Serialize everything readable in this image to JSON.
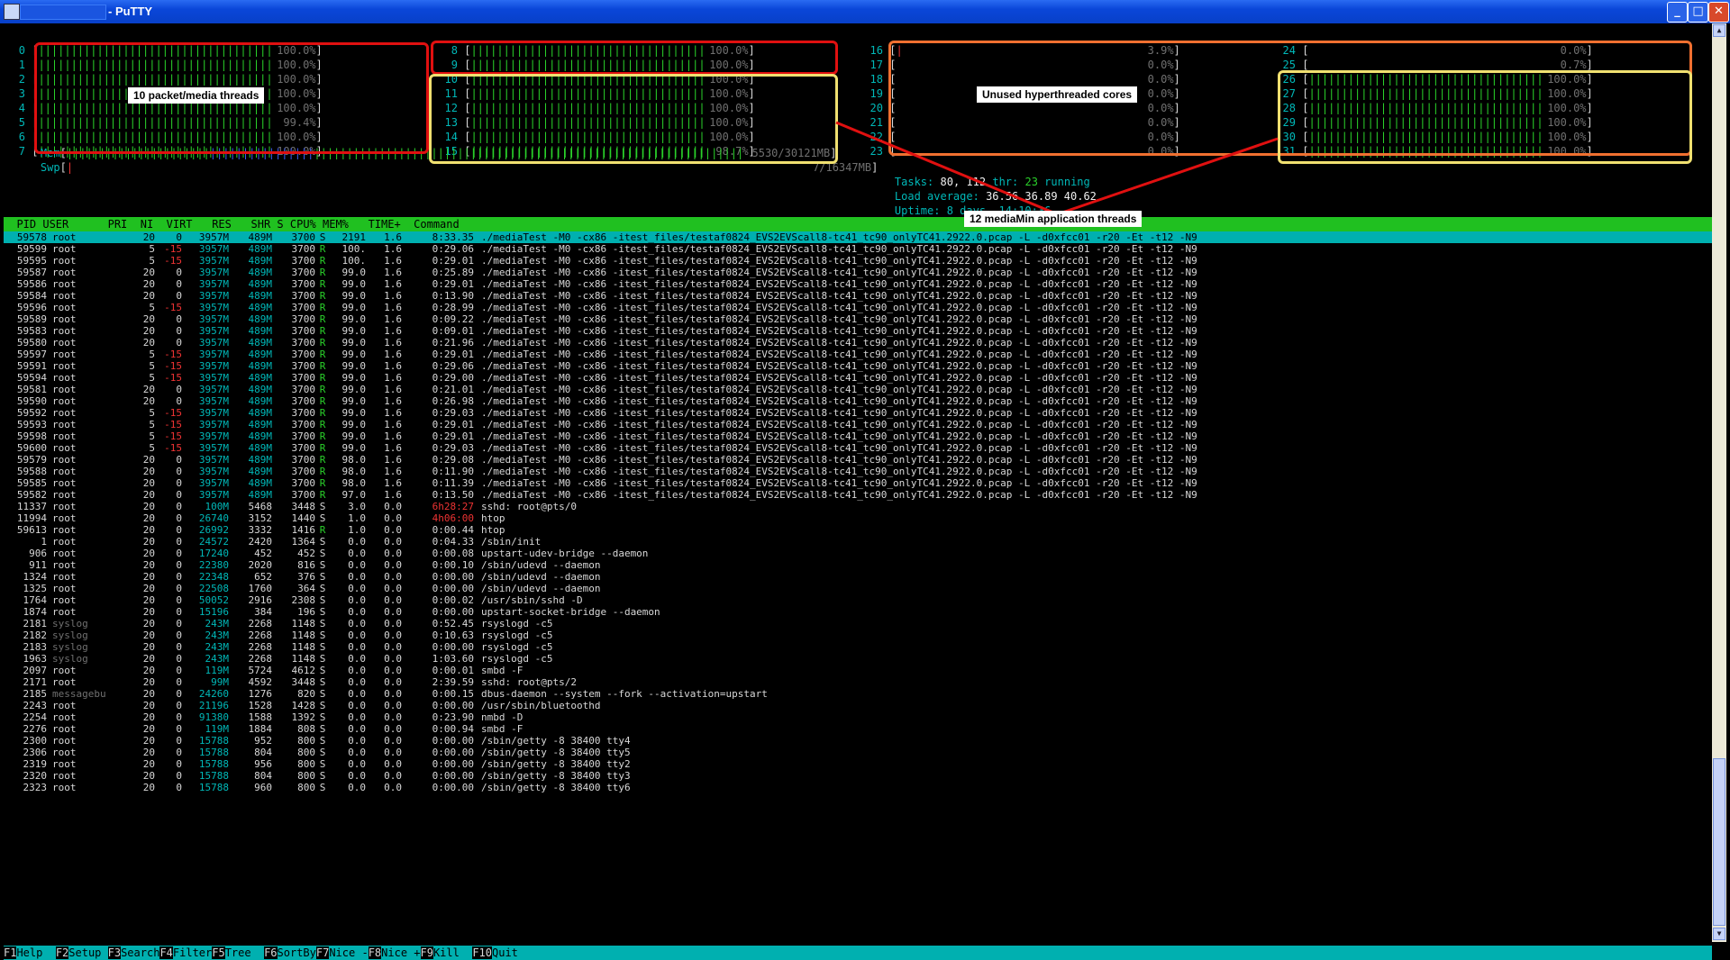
{
  "window": {
    "title": "- PuTTY",
    "minimize": "_",
    "maximize": "□",
    "close": "✕"
  },
  "cpus_left": [
    {
      "n": "0",
      "pct": "100.0%"
    },
    {
      "n": "1",
      "pct": "100.0%"
    },
    {
      "n": "2",
      "pct": "100.0%"
    },
    {
      "n": "3",
      "pct": "100.0%"
    },
    {
      "n": "4",
      "pct": "100.0%"
    },
    {
      "n": "5",
      "pct": "99.4%"
    },
    {
      "n": "6",
      "pct": "100.0%"
    },
    {
      "n": "7",
      "pct": "100.0%"
    }
  ],
  "cpus_mid": [
    {
      "n": "8",
      "pct": "100.0%"
    },
    {
      "n": "9",
      "pct": "100.0%"
    },
    {
      "n": "10",
      "pct": "100.0%"
    },
    {
      "n": "11",
      "pct": "100.0%"
    },
    {
      "n": "12",
      "pct": "100.0%"
    },
    {
      "n": "13",
      "pct": "100.0%"
    },
    {
      "n": "14",
      "pct": "100.0%"
    },
    {
      "n": "15",
      "pct": "98.7%"
    }
  ],
  "cpus_right1": [
    {
      "n": "16",
      "pct": "3.9%"
    },
    {
      "n": "17",
      "pct": "0.0%"
    },
    {
      "n": "18",
      "pct": "0.0%"
    },
    {
      "n": "19",
      "pct": "0.0%"
    },
    {
      "n": "20",
      "pct": "0.0%"
    },
    {
      "n": "21",
      "pct": "0.0%"
    },
    {
      "n": "22",
      "pct": "0.0%"
    },
    {
      "n": "23",
      "pct": "0.0%"
    }
  ],
  "cpus_right2": [
    {
      "n": "24",
      "pct": "0.0%"
    },
    {
      "n": "25",
      "pct": "0.7%"
    },
    {
      "n": "26",
      "pct": "100.0%"
    },
    {
      "n": "27",
      "pct": "100.0%"
    },
    {
      "n": "28",
      "pct": "100.0%"
    },
    {
      "n": "29",
      "pct": "100.0%"
    },
    {
      "n": "30",
      "pct": "100.0%"
    },
    {
      "n": "31",
      "pct": "100.0%"
    }
  ],
  "mem": {
    "label": "Mem",
    "value": "5530/30121MB"
  },
  "swp": {
    "label": "Swp",
    "value": "7/16347MB"
  },
  "tasks": {
    "label": "Tasks:",
    "count": "80,",
    "thr_pre": "112",
    "thr_label": "thr:",
    "running": "23",
    "running_label": "running"
  },
  "load": {
    "label": "Load average:",
    "v1": "36.56",
    "v2": "36.89",
    "v3": "40.62"
  },
  "uptime": {
    "label": "Uptime:",
    "value": "8 days, 14:10:36"
  },
  "header": "  PID USER      PRI  NI  VIRT   RES   SHR S CPU% MEM%   TIME+  Command",
  "callouts": {
    "packet": "10 packet/media threads",
    "unused": "Unused hyperthreaded cores",
    "app": "12 mediaMin application threads"
  },
  "cmd_media": "./mediaTest -M0 -cx86 -itest_files/testaf0824_EVS2EVScall8-tc41_tc90_onlyTC41.2922.0.pcap -L -d0xfcc01 -r20 -Et -t12 -N9",
  "processes": [
    {
      "pid": "59578",
      "user": "root",
      "pri": "20",
      "ni": "0",
      "virt": "3957M",
      "res": "489M",
      "shr": "3700",
      "s": "S",
      "cpu": "2191",
      "mem": "1.6",
      "time": "8:33.35",
      "cmd": "media",
      "sel": true
    },
    {
      "pid": "59599",
      "user": "root",
      "pri": "5",
      "ni": "-15",
      "virt": "3957M",
      "res": "489M",
      "shr": "3700",
      "s": "R",
      "cpu": "100.",
      "mem": "1.6",
      "time": "0:29.06",
      "cmd": "media"
    },
    {
      "pid": "59595",
      "user": "root",
      "pri": "5",
      "ni": "-15",
      "virt": "3957M",
      "res": "489M",
      "shr": "3700",
      "s": "R",
      "cpu": "100.",
      "mem": "1.6",
      "time": "0:29.01",
      "cmd": "media"
    },
    {
      "pid": "59587",
      "user": "root",
      "pri": "20",
      "ni": "0",
      "virt": "3957M",
      "res": "489M",
      "shr": "3700",
      "s": "R",
      "cpu": "99.0",
      "mem": "1.6",
      "time": "0:25.89",
      "cmd": "media"
    },
    {
      "pid": "59586",
      "user": "root",
      "pri": "20",
      "ni": "0",
      "virt": "3957M",
      "res": "489M",
      "shr": "3700",
      "s": "R",
      "cpu": "99.0",
      "mem": "1.6",
      "time": "0:29.01",
      "cmd": "media"
    },
    {
      "pid": "59584",
      "user": "root",
      "pri": "20",
      "ni": "0",
      "virt": "3957M",
      "res": "489M",
      "shr": "3700",
      "s": "R",
      "cpu": "99.0",
      "mem": "1.6",
      "time": "0:13.90",
      "cmd": "media"
    },
    {
      "pid": "59596",
      "user": "root",
      "pri": "5",
      "ni": "-15",
      "virt": "3957M",
      "res": "489M",
      "shr": "3700",
      "s": "R",
      "cpu": "99.0",
      "mem": "1.6",
      "time": "0:28.99",
      "cmd": "media"
    },
    {
      "pid": "59589",
      "user": "root",
      "pri": "20",
      "ni": "0",
      "virt": "3957M",
      "res": "489M",
      "shr": "3700",
      "s": "R",
      "cpu": "99.0",
      "mem": "1.6",
      "time": "0:09.22",
      "cmd": "media"
    },
    {
      "pid": "59583",
      "user": "root",
      "pri": "20",
      "ni": "0",
      "virt": "3957M",
      "res": "489M",
      "shr": "3700",
      "s": "R",
      "cpu": "99.0",
      "mem": "1.6",
      "time": "0:09.01",
      "cmd": "media"
    },
    {
      "pid": "59580",
      "user": "root",
      "pri": "20",
      "ni": "0",
      "virt": "3957M",
      "res": "489M",
      "shr": "3700",
      "s": "R",
      "cpu": "99.0",
      "mem": "1.6",
      "time": "0:21.96",
      "cmd": "media"
    },
    {
      "pid": "59597",
      "user": "root",
      "pri": "5",
      "ni": "-15",
      "virt": "3957M",
      "res": "489M",
      "shr": "3700",
      "s": "R",
      "cpu": "99.0",
      "mem": "1.6",
      "time": "0:29.01",
      "cmd": "media"
    },
    {
      "pid": "59591",
      "user": "root",
      "pri": "5",
      "ni": "-15",
      "virt": "3957M",
      "res": "489M",
      "shr": "3700",
      "s": "R",
      "cpu": "99.0",
      "mem": "1.6",
      "time": "0:29.06",
      "cmd": "media"
    },
    {
      "pid": "59594",
      "user": "root",
      "pri": "5",
      "ni": "-15",
      "virt": "3957M",
      "res": "489M",
      "shr": "3700",
      "s": "R",
      "cpu": "99.0",
      "mem": "1.6",
      "time": "0:29.00",
      "cmd": "media"
    },
    {
      "pid": "59581",
      "user": "root",
      "pri": "20",
      "ni": "0",
      "virt": "3957M",
      "res": "489M",
      "shr": "3700",
      "s": "R",
      "cpu": "99.0",
      "mem": "1.6",
      "time": "0:21.01",
      "cmd": "media"
    },
    {
      "pid": "59590",
      "user": "root",
      "pri": "20",
      "ni": "0",
      "virt": "3957M",
      "res": "489M",
      "shr": "3700",
      "s": "R",
      "cpu": "99.0",
      "mem": "1.6",
      "time": "0:26.98",
      "cmd": "media"
    },
    {
      "pid": "59592",
      "user": "root",
      "pri": "5",
      "ni": "-15",
      "virt": "3957M",
      "res": "489M",
      "shr": "3700",
      "s": "R",
      "cpu": "99.0",
      "mem": "1.6",
      "time": "0:29.03",
      "cmd": "media"
    },
    {
      "pid": "59593",
      "user": "root",
      "pri": "5",
      "ni": "-15",
      "virt": "3957M",
      "res": "489M",
      "shr": "3700",
      "s": "R",
      "cpu": "99.0",
      "mem": "1.6",
      "time": "0:29.01",
      "cmd": "media"
    },
    {
      "pid": "59598",
      "user": "root",
      "pri": "5",
      "ni": "-15",
      "virt": "3957M",
      "res": "489M",
      "shr": "3700",
      "s": "R",
      "cpu": "99.0",
      "mem": "1.6",
      "time": "0:29.01",
      "cmd": "media"
    },
    {
      "pid": "59600",
      "user": "root",
      "pri": "5",
      "ni": "-15",
      "virt": "3957M",
      "res": "489M",
      "shr": "3700",
      "s": "R",
      "cpu": "99.0",
      "mem": "1.6",
      "time": "0:29.03",
      "cmd": "media"
    },
    {
      "pid": "59579",
      "user": "root",
      "pri": "20",
      "ni": "0",
      "virt": "3957M",
      "res": "489M",
      "shr": "3700",
      "s": "R",
      "cpu": "98.0",
      "mem": "1.6",
      "time": "0:29.08",
      "cmd": "media"
    },
    {
      "pid": "59588",
      "user": "root",
      "pri": "20",
      "ni": "0",
      "virt": "3957M",
      "res": "489M",
      "shr": "3700",
      "s": "R",
      "cpu": "98.0",
      "mem": "1.6",
      "time": "0:11.90",
      "cmd": "media"
    },
    {
      "pid": "59585",
      "user": "root",
      "pri": "20",
      "ni": "0",
      "virt": "3957M",
      "res": "489M",
      "shr": "3700",
      "s": "R",
      "cpu": "98.0",
      "mem": "1.6",
      "time": "0:11.39",
      "cmd": "media"
    },
    {
      "pid": "59582",
      "user": "root",
      "pri": "20",
      "ni": "0",
      "virt": "3957M",
      "res": "489M",
      "shr": "3700",
      "s": "R",
      "cpu": "97.0",
      "mem": "1.6",
      "time": "0:13.50",
      "cmd": "media"
    },
    {
      "pid": "11337",
      "user": "root",
      "pri": "20",
      "ni": "0",
      "virt": "100M",
      "res": "5468",
      "shr": "3448",
      "s": "S",
      "cpu": "3.0",
      "mem": "0.0",
      "time": "6h28:27",
      "cmd": "sshd: root@pts/0"
    },
    {
      "pid": "11994",
      "user": "root",
      "pri": "20",
      "ni": "0",
      "virt": "26740",
      "res": "3152",
      "shr": "1440",
      "s": "S",
      "cpu": "1.0",
      "mem": "0.0",
      "time": "4h06:00",
      "cmd": "htop"
    },
    {
      "pid": "59613",
      "user": "root",
      "pri": "20",
      "ni": "0",
      "virt": "26992",
      "res": "3332",
      "shr": "1416",
      "s": "R",
      "cpu": "1.0",
      "mem": "0.0",
      "time": "0:00.44",
      "cmd": "htop"
    },
    {
      "pid": "1",
      "user": "root",
      "pri": "20",
      "ni": "0",
      "virt": "24572",
      "res": "2420",
      "shr": "1364",
      "s": "S",
      "cpu": "0.0",
      "mem": "0.0",
      "time": "0:04.33",
      "cmd": "/sbin/init"
    },
    {
      "pid": "906",
      "user": "root",
      "pri": "20",
      "ni": "0",
      "virt": "17240",
      "res": "452",
      "shr": "452",
      "s": "S",
      "cpu": "0.0",
      "mem": "0.0",
      "time": "0:00.08",
      "cmd": "upstart-udev-bridge --daemon"
    },
    {
      "pid": "911",
      "user": "root",
      "pri": "20",
      "ni": "0",
      "virt": "22380",
      "res": "2020",
      "shr": "816",
      "s": "S",
      "cpu": "0.0",
      "mem": "0.0",
      "time": "0:00.10",
      "cmd": "/sbin/udevd --daemon"
    },
    {
      "pid": "1324",
      "user": "root",
      "pri": "20",
      "ni": "0",
      "virt": "22348",
      "res": "652",
      "shr": "376",
      "s": "S",
      "cpu": "0.0",
      "mem": "0.0",
      "time": "0:00.00",
      "cmd": "/sbin/udevd --daemon"
    },
    {
      "pid": "1325",
      "user": "root",
      "pri": "20",
      "ni": "0",
      "virt": "22508",
      "res": "1760",
      "shr": "364",
      "s": "S",
      "cpu": "0.0",
      "mem": "0.0",
      "time": "0:00.00",
      "cmd": "/sbin/udevd --daemon"
    },
    {
      "pid": "1764",
      "user": "root",
      "pri": "20",
      "ni": "0",
      "virt": "50052",
      "res": "2916",
      "shr": "2308",
      "s": "S",
      "cpu": "0.0",
      "mem": "0.0",
      "time": "0:00.02",
      "cmd": "/usr/sbin/sshd -D"
    },
    {
      "pid": "1874",
      "user": "root",
      "pri": "20",
      "ni": "0",
      "virt": "15196",
      "res": "384",
      "shr": "196",
      "s": "S",
      "cpu": "0.0",
      "mem": "0.0",
      "time": "0:00.00",
      "cmd": "upstart-socket-bridge --daemon"
    },
    {
      "pid": "2181",
      "user": "syslog",
      "pri": "20",
      "ni": "0",
      "virt": "243M",
      "res": "2268",
      "shr": "1148",
      "s": "S",
      "cpu": "0.0",
      "mem": "0.0",
      "time": "0:52.45",
      "cmd": "rsyslogd -c5"
    },
    {
      "pid": "2182",
      "user": "syslog",
      "pri": "20",
      "ni": "0",
      "virt": "243M",
      "res": "2268",
      "shr": "1148",
      "s": "S",
      "cpu": "0.0",
      "mem": "0.0",
      "time": "0:10.63",
      "cmd": "rsyslogd -c5"
    },
    {
      "pid": "2183",
      "user": "syslog",
      "pri": "20",
      "ni": "0",
      "virt": "243M",
      "res": "2268",
      "shr": "1148",
      "s": "S",
      "cpu": "0.0",
      "mem": "0.0",
      "time": "0:00.00",
      "cmd": "rsyslogd -c5"
    },
    {
      "pid": "1963",
      "user": "syslog",
      "pri": "20",
      "ni": "0",
      "virt": "243M",
      "res": "2268",
      "shr": "1148",
      "s": "S",
      "cpu": "0.0",
      "mem": "0.0",
      "time": "1:03.60",
      "cmd": "rsyslogd -c5"
    },
    {
      "pid": "2097",
      "user": "root",
      "pri": "20",
      "ni": "0",
      "virt": "119M",
      "res": "5724",
      "shr": "4612",
      "s": "S",
      "cpu": "0.0",
      "mem": "0.0",
      "time": "0:00.01",
      "cmd": "smbd -F"
    },
    {
      "pid": "2171",
      "user": "root",
      "pri": "20",
      "ni": "0",
      "virt": "99M",
      "res": "4592",
      "shr": "3448",
      "s": "S",
      "cpu": "0.0",
      "mem": "0.0",
      "time": "2:39.59",
      "cmd": "sshd: root@pts/2"
    },
    {
      "pid": "2185",
      "user": "messagebu",
      "pri": "20",
      "ni": "0",
      "virt": "24260",
      "res": "1276",
      "shr": "820",
      "s": "S",
      "cpu": "0.0",
      "mem": "0.0",
      "time": "0:00.15",
      "cmd": "dbus-daemon --system --fork --activation=upstart"
    },
    {
      "pid": "2243",
      "user": "root",
      "pri": "20",
      "ni": "0",
      "virt": "21196",
      "res": "1528",
      "shr": "1428",
      "s": "S",
      "cpu": "0.0",
      "mem": "0.0",
      "time": "0:00.00",
      "cmd": "/usr/sbin/bluetoothd"
    },
    {
      "pid": "2254",
      "user": "root",
      "pri": "20",
      "ni": "0",
      "virt": "91380",
      "res": "1588",
      "shr": "1392",
      "s": "S",
      "cpu": "0.0",
      "mem": "0.0",
      "time": "0:23.90",
      "cmd": "nmbd -D"
    },
    {
      "pid": "2276",
      "user": "root",
      "pri": "20",
      "ni": "0",
      "virt": "119M",
      "res": "1884",
      "shr": "808",
      "s": "S",
      "cpu": "0.0",
      "mem": "0.0",
      "time": "0:00.94",
      "cmd": "smbd -F"
    },
    {
      "pid": "2300",
      "user": "root",
      "pri": "20",
      "ni": "0",
      "virt": "15788",
      "res": "952",
      "shr": "800",
      "s": "S",
      "cpu": "0.0",
      "mem": "0.0",
      "time": "0:00.00",
      "cmd": "/sbin/getty -8 38400 tty4"
    },
    {
      "pid": "2306",
      "user": "root",
      "pri": "20",
      "ni": "0",
      "virt": "15788",
      "res": "804",
      "shr": "800",
      "s": "S",
      "cpu": "0.0",
      "mem": "0.0",
      "time": "0:00.00",
      "cmd": "/sbin/getty -8 38400 tty5"
    },
    {
      "pid": "2319",
      "user": "root",
      "pri": "20",
      "ni": "0",
      "virt": "15788",
      "res": "956",
      "shr": "800",
      "s": "S",
      "cpu": "0.0",
      "mem": "0.0",
      "time": "0:00.00",
      "cmd": "/sbin/getty -8 38400 tty2"
    },
    {
      "pid": "2320",
      "user": "root",
      "pri": "20",
      "ni": "0",
      "virt": "15788",
      "res": "804",
      "shr": "800",
      "s": "S",
      "cpu": "0.0",
      "mem": "0.0",
      "time": "0:00.00",
      "cmd": "/sbin/getty -8 38400 tty3"
    },
    {
      "pid": "2323",
      "user": "root",
      "pri": "20",
      "ni": "0",
      "virt": "15788",
      "res": "960",
      "shr": "800",
      "s": "S",
      "cpu": "0.0",
      "mem": "0.0",
      "time": "0:00.00",
      "cmd": "/sbin/getty -8 38400 tty6"
    }
  ],
  "fkeys": [
    {
      "k": "F1",
      "l": "Help  "
    },
    {
      "k": "F2",
      "l": "Setup "
    },
    {
      "k": "F3",
      "l": "Search"
    },
    {
      "k": "F4",
      "l": "Filter"
    },
    {
      "k": "F5",
      "l": "Tree  "
    },
    {
      "k": "F6",
      "l": "SortBy"
    },
    {
      "k": "F7",
      "l": "Nice -"
    },
    {
      "k": "F8",
      "l": "Nice +"
    },
    {
      "k": "F9",
      "l": "Kill  "
    },
    {
      "k": "F10",
      "l": "Quit  "
    }
  ],
  "colors": {
    "annot_red": "#e01010",
    "annot_yellow": "#f0e070",
    "annot_orange": "#f07030"
  }
}
